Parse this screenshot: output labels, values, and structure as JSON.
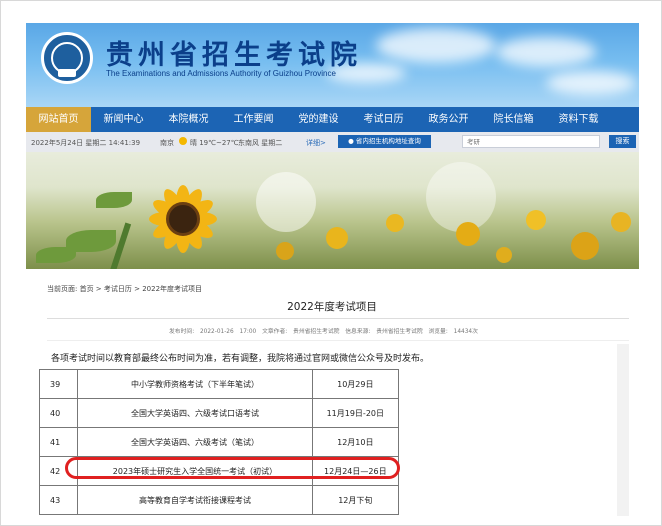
{
  "site": {
    "title": "贵州省招生考试院",
    "subtitle": "The Examinations and Admissions Authority of Guizhou Province",
    "logo_label": "贵州"
  },
  "nav": {
    "items": [
      "网站首页",
      "新闻中心",
      "本院概况",
      "工作要闻",
      "党的建设",
      "考试日历",
      "政务公开",
      "院长信箱",
      "资料下载"
    ],
    "active_index": 0
  },
  "infobar": {
    "datetime": "2022年5月24日 星期二 14:41:39",
    "city": "南京",
    "weather": "晴 19℃~27℃",
    "wind": "东南风 星期二",
    "weather_more": "详细>",
    "org_link": "省内招生机构地址查询",
    "search_placeholder": "考研",
    "search_button": "搜索"
  },
  "breadcrumb": "当前页面: 首页 > 考试日历 > 2022年度考试项目",
  "article": {
    "title": "2022年度考试项目",
    "meta": "发布时间: 2022-01-26 17:00   文章作者: 贵州省招生考试院   信息来源: 贵州省招生考试院   浏览量: 14434次",
    "notice": "各项考试时间以教育部最终公布时间为准，若有调整，我院将通过官网或微信公众号及时发布。"
  },
  "exams": [
    {
      "num": "39",
      "name": "中小学教师资格考试（下半年笔试）",
      "date": "10月29日"
    },
    {
      "num": "40",
      "name": "全国大学英语四、六级考试口语考试",
      "date": "11月19日-20日"
    },
    {
      "num": "41",
      "name": "全国大学英语四、六级考试（笔试）",
      "date": "12月10日"
    },
    {
      "num": "42",
      "name": "2023年硕士研究生入学全国统一考试（初试）",
      "date": "12月24日—26日"
    },
    {
      "num": "43",
      "name": "高等教育自学考试衔接课程考试",
      "date": "12月下旬"
    }
  ],
  "highlighted_row": "42",
  "colors": {
    "nav_bg": "#1c64b4",
    "nav_active": "#d6a53a",
    "title_blue": "#0b3f8a",
    "highlight_red": "#e02020"
  },
  "icons": [
    "weather-sun-icon",
    "location-pin-icon",
    "logo-emblem-icon"
  ]
}
